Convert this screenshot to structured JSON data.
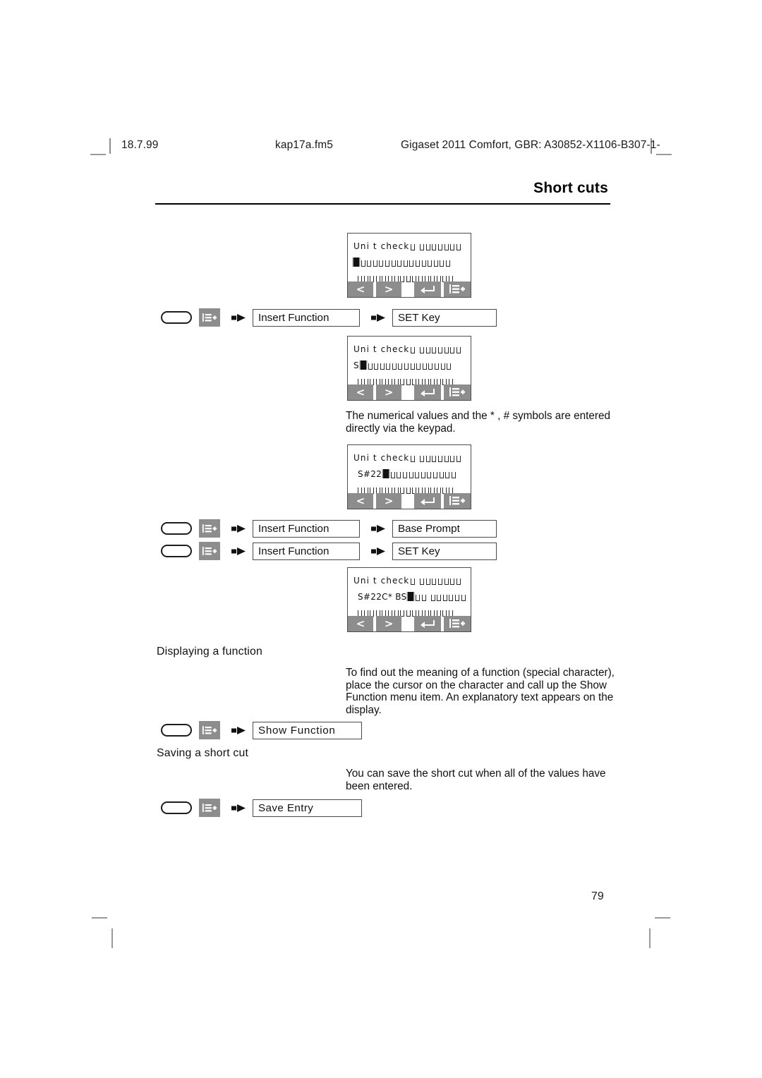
{
  "header": {
    "date": "18.7.99",
    "filename": "kap17a.fm5",
    "document": "Gigaset 2011 Comfort, GBR: A30852-X1106-B307-1-"
  },
  "chapter_title": "Short cuts",
  "page_number": "79",
  "displays": [
    {
      "id": "display-1",
      "line1_text": "Uni t  check",
      "line1_placeholders_before_gap": 1,
      "line1_placeholders_after_gap": 7,
      "line2_text": "",
      "line2_cursor": true,
      "line2_placeholders": 15,
      "line3_placeholders": 16,
      "softkeys": [
        "<",
        ">",
        "enter-icon",
        "menu-icon"
      ]
    },
    {
      "id": "display-2",
      "line1_text": "Uni t  check",
      "line1_placeholders_before_gap": 1,
      "line1_placeholders_after_gap": 7,
      "line2_text": "S",
      "line2_cursor": true,
      "line2_placeholders": 14,
      "line3_placeholders": 16,
      "softkeys": [
        "<",
        ">",
        "enter-icon",
        "menu-icon"
      ]
    },
    {
      "id": "display-3",
      "line1_text": "Uni t  check",
      "line1_placeholders_before_gap": 1,
      "line1_placeholders_after_gap": 7,
      "line2_text": "S#22",
      "line2_cursor": true,
      "line2_placeholders": 11,
      "line3_placeholders": 16,
      "softkeys": [
        "<",
        ">",
        "enter-icon",
        "menu-icon"
      ]
    },
    {
      "id": "display-4",
      "line1_text": "Uni t  check",
      "line1_placeholders_before_gap": 1,
      "line1_placeholders_after_gap": 7,
      "line2_text": "S#22C* BS",
      "line2_cursor": true,
      "line2_placeholders": 8,
      "line3_placeholders": 16,
      "softkeys": [
        "<",
        ">",
        "enter-icon",
        "menu-icon"
      ]
    }
  ],
  "procedures": [
    {
      "id": "proc-1",
      "step1": "Insert Function",
      "step2": "SET Key"
    },
    {
      "id": "proc-2",
      "step1": "Insert Function",
      "step2": "Base Prompt"
    },
    {
      "id": "proc-3",
      "step1": "Insert Function",
      "step2": "SET Key"
    },
    {
      "id": "proc-4",
      "step1": "Show Function",
      "step2": null
    },
    {
      "id": "proc-5",
      "step1": "Save Entry",
      "step2": null
    }
  ],
  "paragraphs": {
    "keypad_note": "The numerical values and the * , # symbols are entered directly via the keypad.",
    "display_function_heading": "Displaying a function",
    "display_function_body": "To find out the meaning of a function (special character), place the cursor on the character and call up the Show Function menu item. An explanatory text appears on the display.",
    "saving_heading": "Saving a short cut",
    "saving_body": "You can save the short cut when all of the values have been entered."
  },
  "colors": {
    "softkey_gray": "#8d8d8d",
    "icon_gray": "#8d8d8d",
    "text": "#111111",
    "rule": "#000000"
  }
}
